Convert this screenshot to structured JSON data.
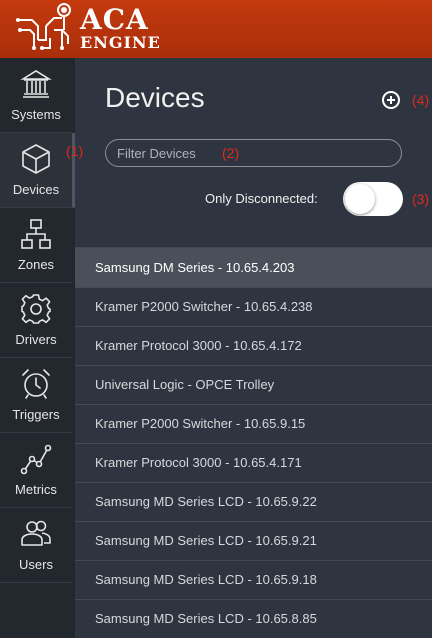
{
  "header": {
    "logo_line1": "ACA",
    "logo_line2": "ENGINE",
    "background": "#b8330c"
  },
  "sidebar": {
    "items": [
      {
        "label": "Systems",
        "icon": "bank-icon"
      },
      {
        "label": "Devices",
        "icon": "cube-icon",
        "active": true
      },
      {
        "label": "Zones",
        "icon": "hierarchy-icon"
      },
      {
        "label": "Drivers",
        "icon": "gear-icon"
      },
      {
        "label": "Triggers",
        "icon": "alarm-clock-icon"
      },
      {
        "label": "Metrics",
        "icon": "line-graph-icon"
      },
      {
        "label": "Users",
        "icon": "users-icon"
      }
    ]
  },
  "main": {
    "title": "Devices",
    "filter_placeholder": "Filter Devices",
    "toggle_label": "Only Disconnected:",
    "toggle_on": false,
    "annotations": [
      "(1)",
      "(2)",
      "(3)",
      "(4)"
    ],
    "devices": [
      "Samsung DM Series - 10.65.4.203",
      "Kramer P2000 Switcher - 10.65.4.238",
      "Kramer Protocol 3000 - 10.65.4.172",
      "Universal Logic - OPCE Trolley",
      "Kramer P2000 Switcher - 10.65.9.15",
      "Kramer Protocol 3000 - 10.65.4.171",
      "Samsung MD Series LCD - 10.65.9.22",
      "Samsung MD Series LCD - 10.65.9.21",
      "Samsung MD Series LCD - 10.65.9.18",
      "Samsung MD Series LCD - 10.65.8.85"
    ]
  },
  "colors": {
    "accent": "#b8330c",
    "annotation": "#e0281c",
    "sidebar_bg": "#23272e",
    "main_bg": "#2f3540",
    "selected_row": "#4a505a"
  }
}
